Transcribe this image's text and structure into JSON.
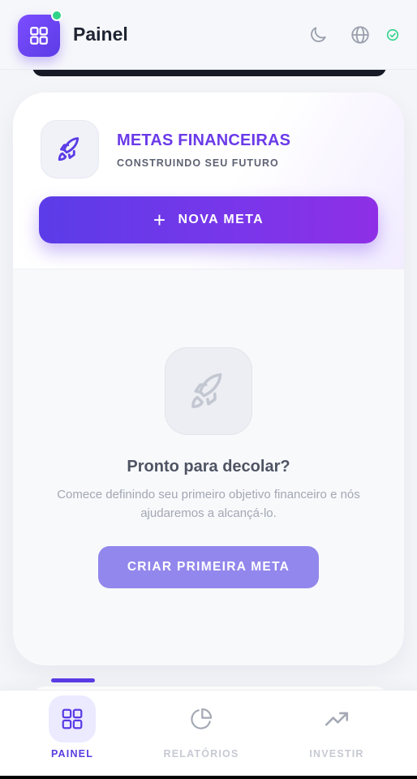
{
  "header": {
    "title": "Painel",
    "icons": [
      "dashboard-icon",
      "moon-icon",
      "globe-icon",
      "check-circle-icon"
    ]
  },
  "section": {
    "title": "METAS FINANCEIRAS",
    "subtitle": "CONSTRUINDO SEU FUTURO",
    "icon": "rocket-icon",
    "new_goal_label": "NOVA META"
  },
  "empty_state": {
    "icon": "rocket-icon",
    "title": "Pronto para decolar?",
    "description": "Comece definindo seu primeiro objetivo financeiro e nós ajudaremos a alcançá-lo.",
    "button_label": "CRIAR PRIMEIRA META"
  },
  "bottom_nav": {
    "items": [
      {
        "label": "PAINEL",
        "icon": "dashboard-icon",
        "active": true
      },
      {
        "label": "RELATÓRIOS",
        "icon": "pie-chart-icon",
        "active": false
      },
      {
        "label": "INVESTIR",
        "icon": "trending-up-icon",
        "active": false
      }
    ]
  },
  "colors": {
    "accent": "#5b3ce6",
    "accent_purple": "#8e2fe6",
    "online": "#2fd38a",
    "soft_button": "#9287ec"
  }
}
